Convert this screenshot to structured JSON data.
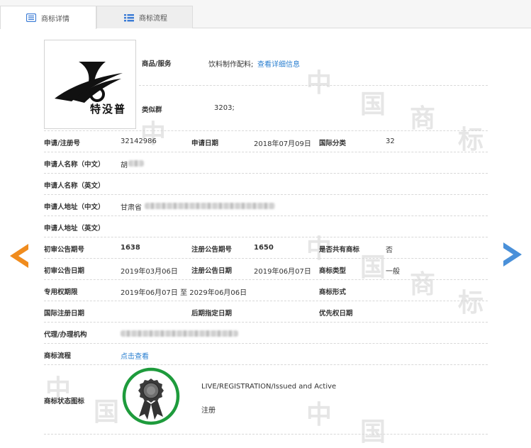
{
  "tabs": [
    {
      "label": "商标详情",
      "active": true,
      "icon": "detail-list-icon"
    },
    {
      "label": "商标流程",
      "active": false,
      "icon": "process-list-icon"
    }
  ],
  "logo": {
    "text": "特没普"
  },
  "goods": {
    "label": "商品/服务",
    "value": "饮料制作配料;",
    "link": "查看详细信息"
  },
  "similar_group": {
    "label": "类似群",
    "value": "3203;"
  },
  "rows": {
    "reg_no": {
      "label": "申请/注册号",
      "value": "32142986"
    },
    "app_date": {
      "label": "申请日期",
      "value": "2018年07月09日"
    },
    "intl_class": {
      "label": "国际分类",
      "value": "32"
    },
    "applicant_cn": {
      "label": "申请人名称（中文）",
      "value": "胡"
    },
    "applicant_en": {
      "label": "申请人名称（英文）",
      "value": ""
    },
    "address_cn": {
      "label": "申请人地址（中文）",
      "value": "甘肃省"
    },
    "address_en": {
      "label": "申请人地址（英文）",
      "value": ""
    },
    "prelim_no": {
      "label": "初审公告期号",
      "value": "1638"
    },
    "reg_pub_no": {
      "label": "注册公告期号",
      "value": "1650"
    },
    "shared": {
      "label": "是否共有商标",
      "value": "否"
    },
    "prelim_date": {
      "label": "初审公告日期",
      "value": "2019年03月06日"
    },
    "reg_pub_date": {
      "label": "注册公告日期",
      "value": "2019年06月07日"
    },
    "mark_type": {
      "label": "商标类型",
      "value": "一般"
    },
    "exclusive": {
      "label": "专用权期限",
      "value": "2019年06月07日 至 2029年06月06日"
    },
    "mark_form": {
      "label": "商标形式",
      "value": ""
    },
    "intl_reg_date": {
      "label": "国际注册日期",
      "value": ""
    },
    "later_date": {
      "label": "后期指定日期",
      "value": ""
    },
    "priority_date": {
      "label": "优先权日期",
      "value": ""
    },
    "agent": {
      "label": "代理/办理机构",
      "value": ""
    },
    "process": {
      "label": "商标流程",
      "link": "点击查看"
    },
    "status": {
      "label": "商标状态图标",
      "line1": "LIVE/REGISTRATION/Issued and Active",
      "line2": "注册"
    }
  },
  "watermark": {
    "chars": [
      "中",
      "国",
      "商",
      "标"
    ]
  },
  "colors": {
    "link": "#2a7fd0",
    "prev_arrow": "#f08c1e",
    "next_arrow": "#4a90d9",
    "seal_ring": "#1e9b3c"
  }
}
